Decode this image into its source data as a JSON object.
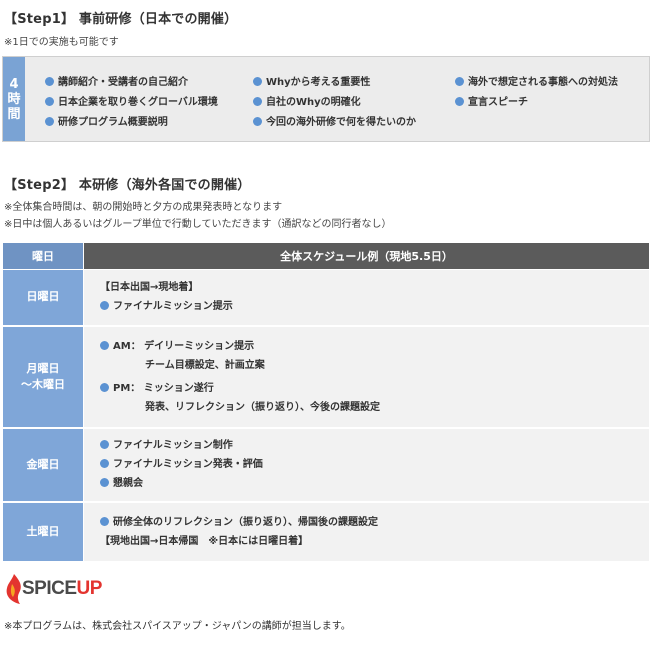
{
  "step1": {
    "title": "【Step1】 事前研修（日本での開催）",
    "note": "※1日での実施も可能です",
    "tag_chars": [
      "4",
      "時",
      "間"
    ],
    "items": [
      "講師紹介・受講者の自己紹介",
      "Whyから考える重要性",
      "海外で想定される事態への対処法",
      "日本企業を取り巻くグローバル環境",
      "自社のWhyの明確化",
      "宣言スピーチ",
      "研修プログラム概要説明",
      "今回の海外研修で何を得たいのか"
    ]
  },
  "step2": {
    "title": "【Step2】 本研修（海外各国での開催）",
    "notes": [
      "※全体集合時間は、朝の開始時と夕方の成果発表時となります",
      "※日中は個人あるいはグループ単位で行動していただきます（通訳などの同行者なし）"
    ]
  },
  "schedule": {
    "header_day": "曜日",
    "header_main": "全体スケジュール例（現地5.5日）",
    "rows": [
      {
        "day": "日曜日",
        "lines": [
          "【日本出国→現地着】",
          "ファイナルミッション提示"
        ]
      },
      {
        "day_1": "月曜日",
        "day_2": "〜木曜日",
        "lines": [
          "AM： デイリーミッション提示",
          "チーム目標設定、計画立案",
          "PM： ミッション遂行",
          "発表、リフレクション（振り返り）、今後の課題設定"
        ]
      },
      {
        "day": "金曜日",
        "lines": [
          "ファイナルミッション制作",
          "ファイナルミッション発表・評価",
          "懇親会"
        ]
      },
      {
        "day": "土曜日",
        "lines": [
          "研修全体のリフレクション（振り返り）、帰国後の課題設定",
          "【現地出国→日本帰国　※日本には日曜日着】"
        ]
      }
    ]
  },
  "logo": {
    "part1": "SPICE",
    "part2": "UP"
  },
  "footer": "※本プログラムは、株式会社スパイスアップ・ジャパンの講師が担当します。",
  "colors": {
    "accent_blue": "#7fa6d8",
    "dot_blue": "#5b92d2",
    "header_dark": "#5b5b5b",
    "logo_red": "#e3342f"
  }
}
